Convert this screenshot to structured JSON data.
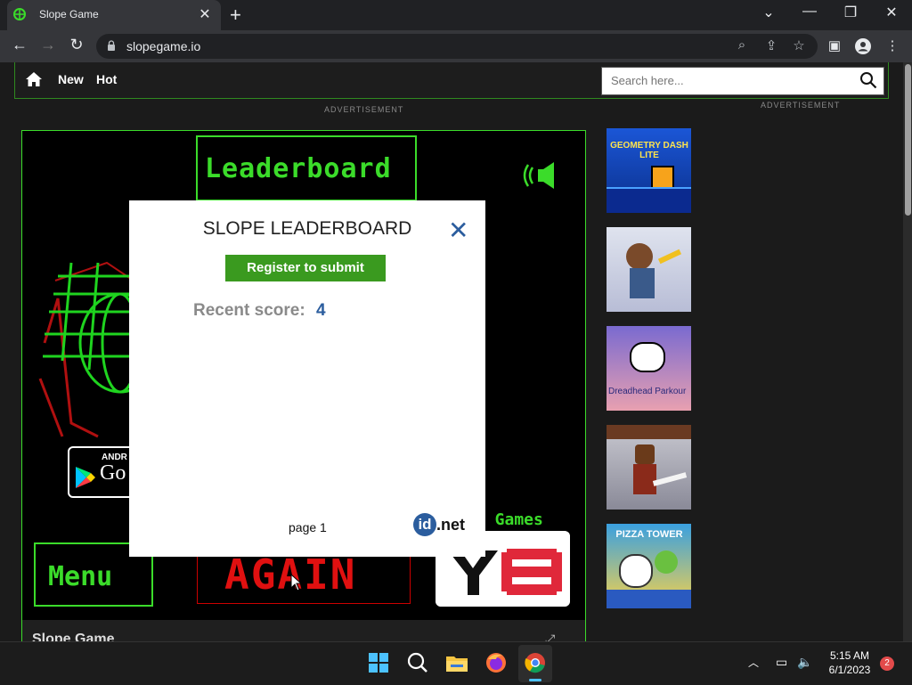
{
  "browser": {
    "tab_title": "Slope Game",
    "tab_close": "✕",
    "new_tab": "+",
    "url": "slopegame.io",
    "window_controls": [
      "⌄",
      "—",
      "❐",
      "✕"
    ]
  },
  "site": {
    "nav_links": [
      "New",
      "Hot"
    ],
    "search_placeholder": "Search here...",
    "ad_label": "ADVERTISEMENT"
  },
  "game": {
    "banner_text": "Leaderboard",
    "android_line1": "ANDR",
    "android_line2": "Go",
    "more_games": "e Games",
    "menu_label": "Menu",
    "again_label": "AGAIN",
    "title_cut": "Slope Game"
  },
  "modal": {
    "title": "SLOPE LEADERBOARD",
    "close": "✕",
    "register_button": "Register to submit",
    "score_label": "Recent score:",
    "score_value": "4",
    "page_label": "page 1",
    "logo_text": ".net",
    "logo_prefix": "id"
  },
  "sidebar": {
    "games": [
      {
        "name": "Geometry Dash Lite",
        "label": "GEOMETRY DASH LITE"
      },
      {
        "name": "Jetpack Joyride",
        "label": ""
      },
      {
        "name": "Dreadhead Parkour",
        "label": "Dreadhead Parkour"
      },
      {
        "name": "Pixel sword game",
        "label": ""
      },
      {
        "name": "Pizza Tower",
        "label": "PIZZA TOWER"
      }
    ]
  },
  "taskbar": {
    "time": "5:15 AM",
    "date": "6/1/2023",
    "notifications": "2"
  }
}
